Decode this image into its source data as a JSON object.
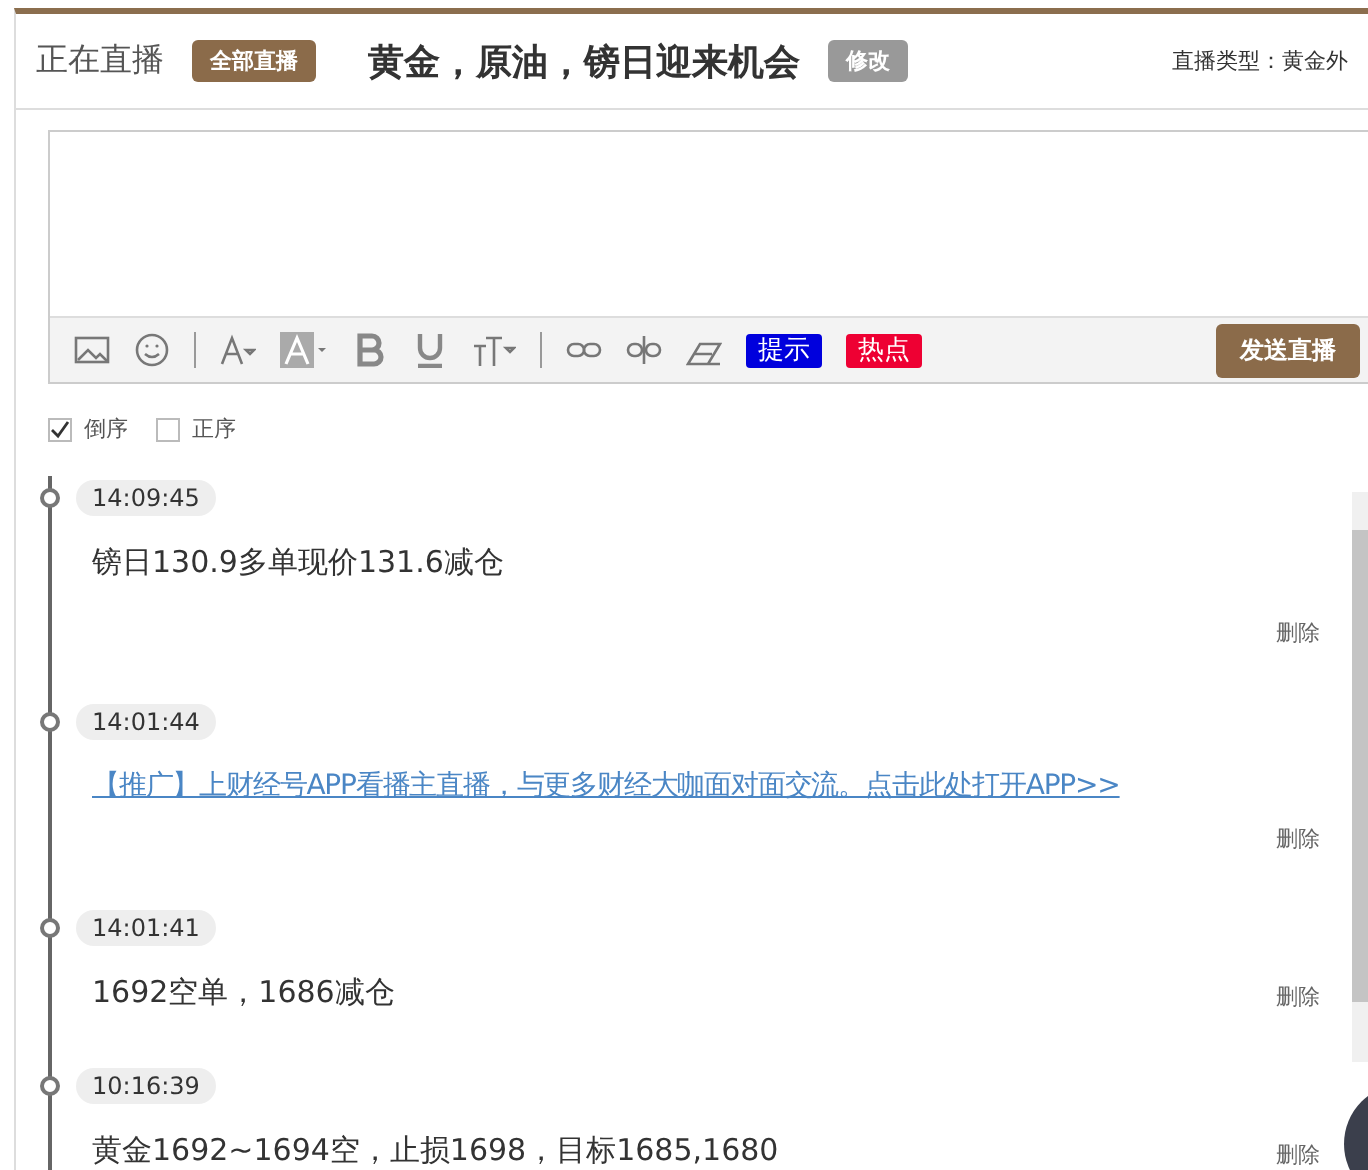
{
  "header": {
    "status": "正在直播",
    "all_button": "全部直播",
    "title": "黄金，原油，镑日迎来机会",
    "edit_button": "修改",
    "type_label": "直播类型：黄金外"
  },
  "editor": {
    "toolbar": [
      {
        "kind": "icon"
      },
      {
        "kind": "icon"
      },
      {
        "kind": "separator"
      },
      {
        "kind": "icon"
      },
      {
        "kind": "icon"
      },
      {
        "kind": "icon"
      },
      {
        "kind": "icon"
      },
      {
        "kind": "icon"
      },
      {
        "kind": "separator"
      },
      {
        "kind": "icon"
      },
      {
        "kind": "icon"
      },
      {
        "kind": "icon"
      },
      {
        "kind": "tag",
        "label": "提示",
        "color": "#0000dd"
      },
      {
        "kind": "tag",
        "label": "热点",
        "color": "#ee0033"
      }
    ],
    "send_button": "发送直播"
  },
  "sort_options": [
    {
      "label": "倒序",
      "checked": true
    },
    {
      "label": "正序",
      "checked": false
    }
  ],
  "entries": [
    {
      "time": "14:09:45",
      "kind": "text",
      "text": "镑日130.9多单现价131.6减仓",
      "delete": "删除"
    },
    {
      "time": "14:01:44",
      "kind": "link",
      "text": "【推广】上财经号APP看播主直播，与更多财经大咖面对面交流。点击此处打开APP>>",
      "delete": "删除"
    },
    {
      "time": "14:01:41",
      "kind": "text",
      "text": "1692空单，1686减仓",
      "delete": "删除"
    },
    {
      "time": "10:16:39",
      "kind": "text",
      "text": "黄金1692~1694空，止损1698，目标1685,1680",
      "delete": "删除"
    }
  ]
}
